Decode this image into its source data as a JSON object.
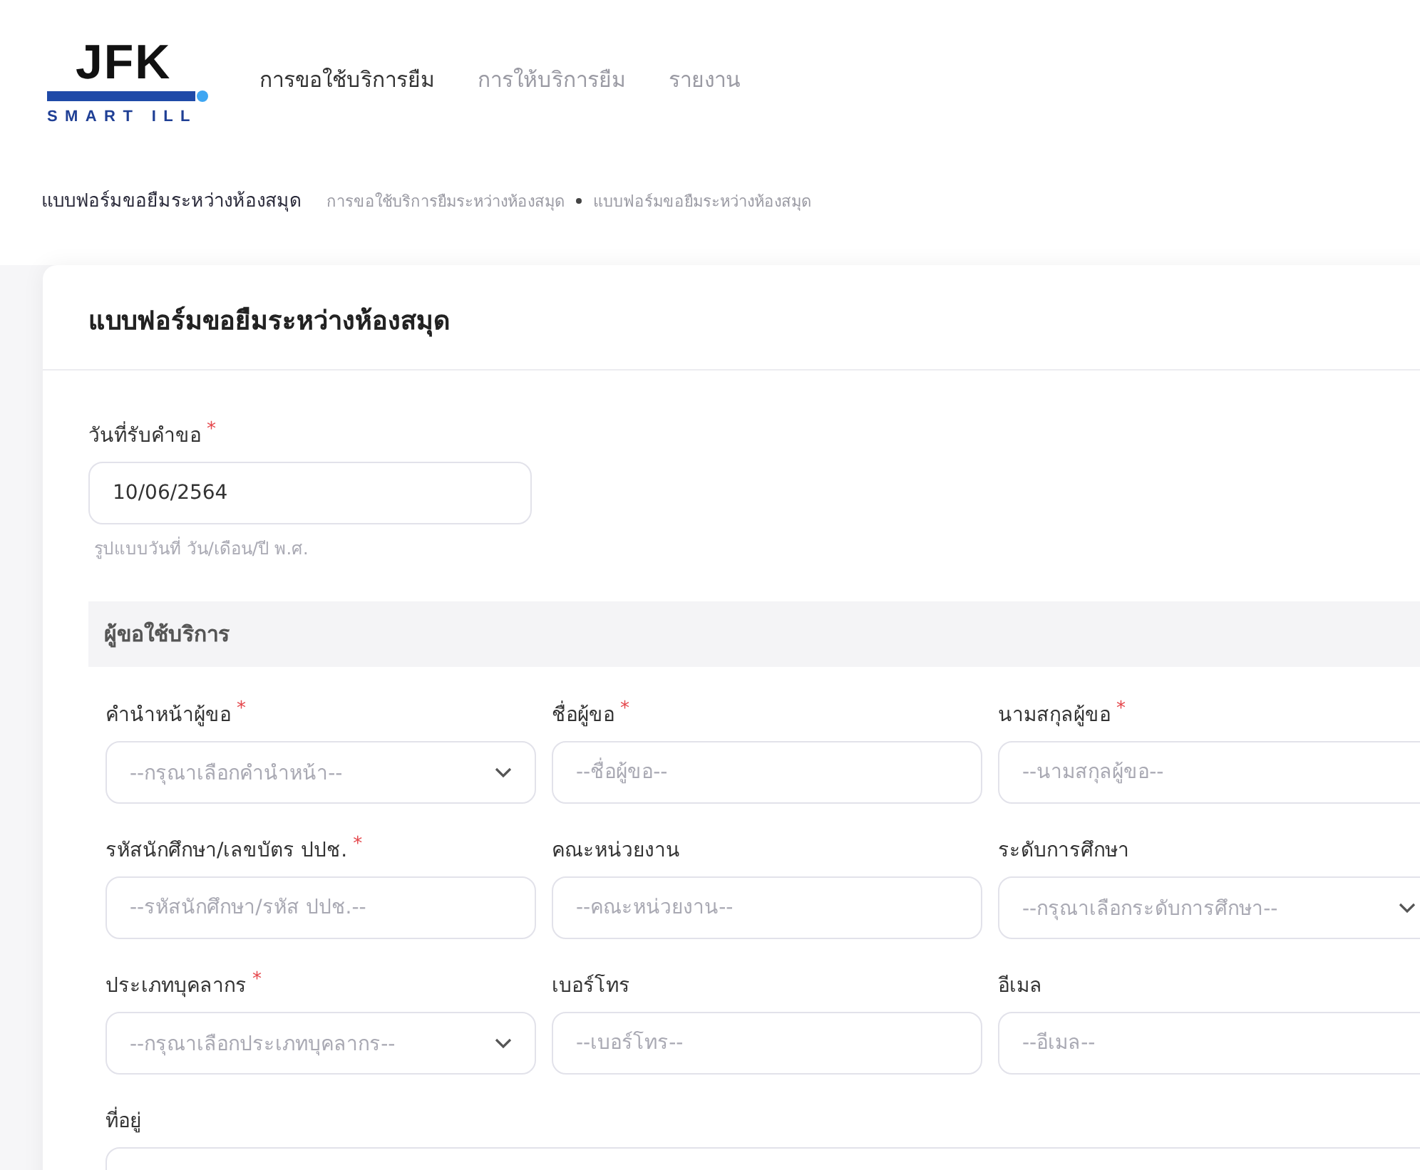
{
  "logo": {
    "name": "JFK",
    "tagline": "SMART ILL"
  },
  "nav": [
    {
      "label": "การขอใช้บริการยืม",
      "selected": true
    },
    {
      "label": "การให้บริการยืม",
      "selected": false
    },
    {
      "label": "รายงาน",
      "selected": false
    }
  ],
  "page_title": "แบบฟอร์มขอยืมระหว่างห้องสมุด",
  "breadcrumb": [
    "การขอใช้บริการยืมระหว่างห้องสมุด",
    "แบบฟอร์มขอยืมระหว่างห้องสมุด"
  ],
  "form": {
    "title": "แบบฟอร์มขอยืมระหว่างห้องสมุด",
    "date_field": {
      "label": "วันที่รับคำขอ",
      "marker": "*",
      "value": "10/06/2564",
      "hint": "รูปแบบวันที่ วัน/เดือน/ปี พ.ศ."
    },
    "section": {
      "title": "ผู้ขอใช้บริการ",
      "fields": [
        {
          "label": "คำนำหน้าผู้ขอ",
          "marker": "*",
          "kind": "select",
          "placeholder": "--กรุณาเลือกคำนำหน้า--"
        },
        {
          "label": "ชื่อผู้ขอ",
          "marker": "*",
          "kind": "text",
          "placeholder": "--ชื่อผู้ขอ--"
        },
        {
          "label": "นามสกุลผู้ขอ",
          "marker": "*",
          "kind": "text",
          "placeholder": "--นามสกุลผู้ขอ--"
        },
        {
          "label": "รหัสนักศึกษา/เลขบัตร ปปช.",
          "marker": "*",
          "kind": "text",
          "placeholder": "--รหัสนักศึกษา/รหัส ปปช.--"
        },
        {
          "label": "คณะหน่วยงาน",
          "kind": "text",
          "placeholder": "--คณะหน่วยงาน--"
        },
        {
          "label": "ระดับการศึกษา",
          "kind": "select",
          "placeholder": "--กรุณาเลือกระดับการศึกษา--"
        },
        {
          "label": "ประเภทบุคลากร",
          "marker": "*",
          "kind": "select",
          "placeholder": "--กรุณาเลือกประเภทบุคลากร--"
        },
        {
          "label": "เบอร์โทร",
          "kind": "text",
          "placeholder": "--เบอร์โทร--"
        },
        {
          "label": "อีเมล",
          "kind": "text",
          "placeholder": "--อีเมล--"
        },
        {
          "label": "ที่อยู่",
          "kind": "wide"
        }
      ]
    }
  }
}
